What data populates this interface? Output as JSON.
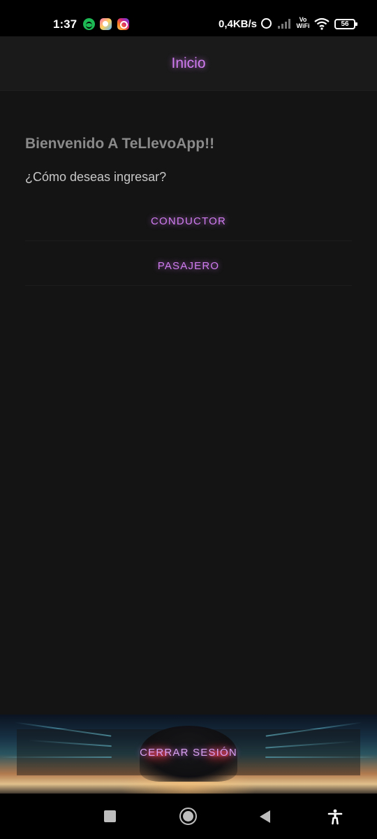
{
  "status_bar": {
    "time": "1:37",
    "network_speed": "0,4KB/s",
    "volte_label": "Vo WiFi",
    "battery_level": "56",
    "notification_icons": [
      "spotify-icon",
      "lens-icon",
      "instagram-icon"
    ],
    "system_icons": [
      "alarm-icon",
      "signal-icon",
      "volte-icon",
      "wifi-icon",
      "battery-icon"
    ]
  },
  "header": {
    "title": "Inicio"
  },
  "main": {
    "welcome": "Bienvenido A TeLlevoApp!!",
    "question": "¿Cómo deseas ingresar?",
    "buttons": [
      {
        "label": "CONDUCTOR"
      },
      {
        "label": "PASAJERO"
      }
    ]
  },
  "footer": {
    "logout_label": "CERRAR SESIÓN"
  },
  "nav_bar": {
    "icons": [
      "recents-icon",
      "home-icon",
      "back-icon",
      "accessibility-icon"
    ]
  },
  "colors": {
    "accent": "#d07cf0",
    "background": "#141414",
    "header_background": "#1a1a1a",
    "status_bar": "#000000"
  }
}
